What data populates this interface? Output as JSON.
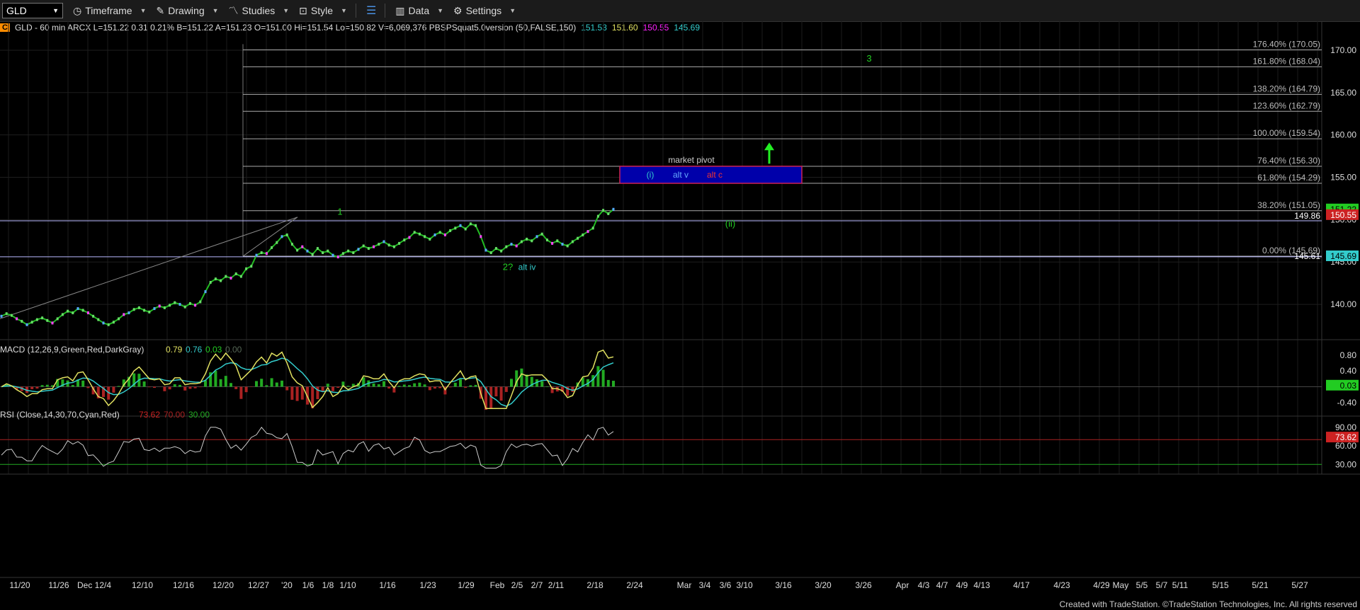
{
  "toolbar": {
    "symbol": "GLD",
    "timeframe": "Timeframe",
    "drawing": "Drawing",
    "studies": "Studies",
    "style": "Style",
    "data": "Data",
    "settings": "Settings"
  },
  "info": {
    "prefix": "C",
    "main": "GLD - 60 min  ARCX  L=151.22  0.31  0.21%  B=151.22  A=151.23  O=151.00  Hi=151.54  Lo=150.82  V=6,069,376  PBSPSquat5.0version (50,FALSE,150)",
    "v1": "151.53",
    "v2": "151.60",
    "v3": "150.55",
    "v4": "145.69"
  },
  "colors": {
    "bg": "#000000",
    "green": "#22cc22",
    "red": "#cc2222",
    "cyan": "#33cccc",
    "navy": "#0000aa",
    "magenta": "#ff22ff"
  },
  "chart_data": {
    "type": "line",
    "symbol": "GLD",
    "interval": "60 min",
    "price_axis": {
      "ylim": [
        136.5,
        172
      ],
      "ticks": [
        140.0,
        145.0,
        150.0,
        155.0,
        160.0,
        165.0,
        170.0
      ],
      "current_labels": [
        {
          "text": "151.22",
          "value": 151.22,
          "color": "#22cc22"
        },
        {
          "text": "150.55",
          "value": 150.55,
          "color": "#cc2222"
        },
        {
          "text": "149.86",
          "value": 149.86,
          "color": "#ffffff"
        },
        {
          "text": "145.69",
          "value": 145.69,
          "color": "#33cccc"
        },
        {
          "text": "145.61",
          "value": 145.61,
          "color": "#ffffff"
        }
      ]
    },
    "fib_levels": [
      {
        "label": "176.40% (170.05)",
        "value": 170.05
      },
      {
        "label": "161.80% (168.04)",
        "value": 168.04
      },
      {
        "label": "138.20% (164.79)",
        "value": 164.79
      },
      {
        "label": "123.60% (162.79)",
        "value": 162.79
      },
      {
        "label": "100.00% (159.54)",
        "value": 159.54
      },
      {
        "label": "76.40% (156.30)",
        "value": 156.3
      },
      {
        "label": "61.80% (154.29)",
        "value": 154.29
      },
      {
        "label": "38.20% (151.05)",
        "value": 151.05
      },
      {
        "label": "0.00% (145.69)",
        "value": 145.69
      }
    ],
    "horizontal_lines": [
      149.86,
      145.61
    ],
    "pivot_box": {
      "top": 156.3,
      "bottom": 154.29,
      "title": "market pivot",
      "labels": [
        "(i)",
        "alt v",
        "alt c"
      ]
    },
    "wave_labels": [
      {
        "text": "3",
        "x_index": 162,
        "price": 169.0,
        "color": "#22cc22"
      },
      {
        "text": "1",
        "x_index": 56,
        "price": 150.9,
        "color": "#22cc22"
      },
      {
        "text": "(ii)",
        "x_index": 136,
        "price": 149.5,
        "color": "#22cc22"
      },
      {
        "text": "2?",
        "x_index": 95,
        "price": 144.4,
        "color": "#22cc22"
      },
      {
        "text": "alt iv",
        "x_index": 99,
        "price": 144.4,
        "color": "#33cccc"
      }
    ],
    "x_labels": [
      "11/20",
      "11/26",
      "Dec 12/4",
      "12/10",
      "12/16",
      "12/20",
      "12/27",
      "'20",
      "1/6",
      "1/8",
      "1/10",
      "1/16",
      "1/23",
      "1/29",
      "Feb",
      "2/5",
      "2/7",
      "2/11",
      "2/18",
      "2/24",
      "Mar",
      "3/4",
      "3/6",
      "3/10",
      "3/16",
      "3/20",
      "3/26",
      "Apr",
      "4/3",
      "4/7",
      "4/9",
      "4/13",
      "4/17",
      "4/23",
      "4/29",
      "May",
      "5/5",
      "5/7",
      "5/11",
      "5/15",
      "5/21",
      "5/27"
    ],
    "price_series": [
      138.6,
      138.9,
      138.7,
      138.3,
      138.0,
      137.6,
      137.9,
      138.2,
      138.4,
      138.1,
      137.8,
      138.3,
      138.8,
      139.2,
      139.0,
      139.5,
      139.3,
      139.0,
      138.6,
      138.2,
      137.8,
      137.6,
      137.9,
      138.3,
      138.8,
      139.0,
      139.4,
      139.6,
      139.3,
      139.1,
      139.5,
      139.8,
      139.6,
      139.9,
      140.2,
      140.0,
      139.7,
      140.1,
      139.9,
      140.3,
      141.5,
      142.6,
      143.0,
      142.8,
      143.3,
      143.1,
      143.6,
      143.3,
      144.2,
      144.5,
      145.8,
      146.1,
      146.0,
      146.7,
      147.3,
      148.0,
      148.2,
      147.1,
      146.4,
      146.8,
      146.3,
      145.9,
      146.6,
      146.1,
      146.3,
      145.8,
      145.6,
      146.0,
      146.3,
      146.1,
      146.5,
      146.9,
      146.6,
      146.8,
      147.1,
      147.4,
      147.0,
      146.8,
      147.2,
      147.6,
      147.9,
      148.5,
      148.3,
      148.0,
      147.7,
      148.2,
      148.5,
      148.2,
      148.7,
      149.0,
      149.3,
      148.9,
      149.5,
      149.3,
      148.0,
      146.4,
      146.1,
      146.6,
      146.3,
      146.8,
      147.1,
      146.9,
      147.4,
      147.7,
      147.5,
      148.0,
      148.3,
      147.6,
      147.2,
      147.5,
      147.1,
      146.9,
      147.4,
      147.8,
      148.2,
      148.6,
      149.0,
      150.4,
      151.1,
      150.7,
      151.22
    ],
    "macd": {
      "label": "MACD (12,26,9,Green,Red,DarkGray)",
      "values": [
        {
          "text": "0.79",
          "color": "#e0e060"
        },
        {
          "text": "0.76",
          "color": "#33cccc"
        },
        {
          "text": "0.03",
          "color": "#22cc22"
        },
        {
          "text": "0.00",
          "color": "#556655"
        }
      ],
      "ticks": [
        0.8,
        0.4,
        0.03,
        -0.4
      ],
      "ylim": [
        -0.6,
        1.1
      ]
    },
    "rsi": {
      "label": "RSI (Close,14,30,70,Cyan,Red)",
      "values": [
        {
          "text": "73.62",
          "color": "#cc2222"
        },
        {
          "text": "70.00",
          "color": "#aa2222"
        },
        {
          "text": "30.00",
          "color": "#22aa22"
        }
      ],
      "ticks": [
        90.0,
        73.62,
        60.0,
        30.0
      ],
      "ylim": [
        20,
        100
      ]
    }
  },
  "footer": "Created with TradeStation. ©TradeStation Technologies, Inc. All rights reserved"
}
